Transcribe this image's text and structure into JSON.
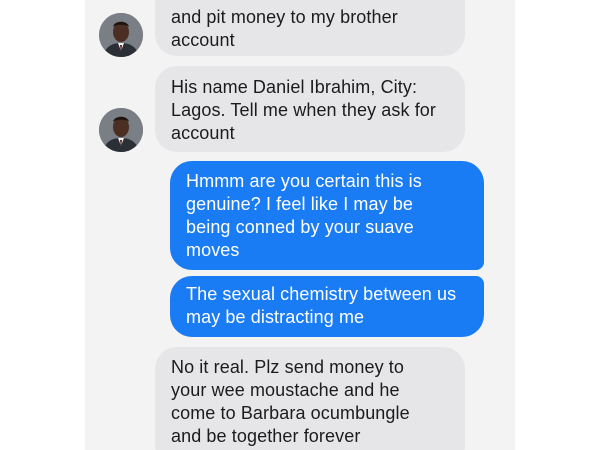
{
  "conversation": {
    "messages": [
      {
        "direction": "incoming",
        "lines": [
          "and pit money to my brother",
          "account"
        ]
      },
      {
        "direction": "incoming",
        "lines": [
          "His name Daniel Ibrahim, City:",
          "Lagos. Tell me when they ask for",
          "account"
        ]
      },
      {
        "direction": "outgoing",
        "lines": [
          "Hmmm are you certain this is",
          "genuine? I feel like I may be",
          "being conned by your suave",
          "moves"
        ]
      },
      {
        "direction": "outgoing",
        "lines": [
          "The sexual chemistry between us",
          "may be distracting me"
        ]
      },
      {
        "direction": "incoming",
        "lines": [
          "No it real. Plz send money to",
          "your wee moustache and he",
          "come to Barbara ocumbungle",
          "and be together forever"
        ]
      }
    ]
  },
  "avatars": [
    {
      "icon": "contact-photo-icon"
    },
    {
      "icon": "contact-photo-icon"
    }
  ],
  "colors": {
    "incoming_bubble": "#e6e6e9",
    "outgoing_bubble": "#1a7cf5",
    "chat_background": "#f3f3f4"
  }
}
